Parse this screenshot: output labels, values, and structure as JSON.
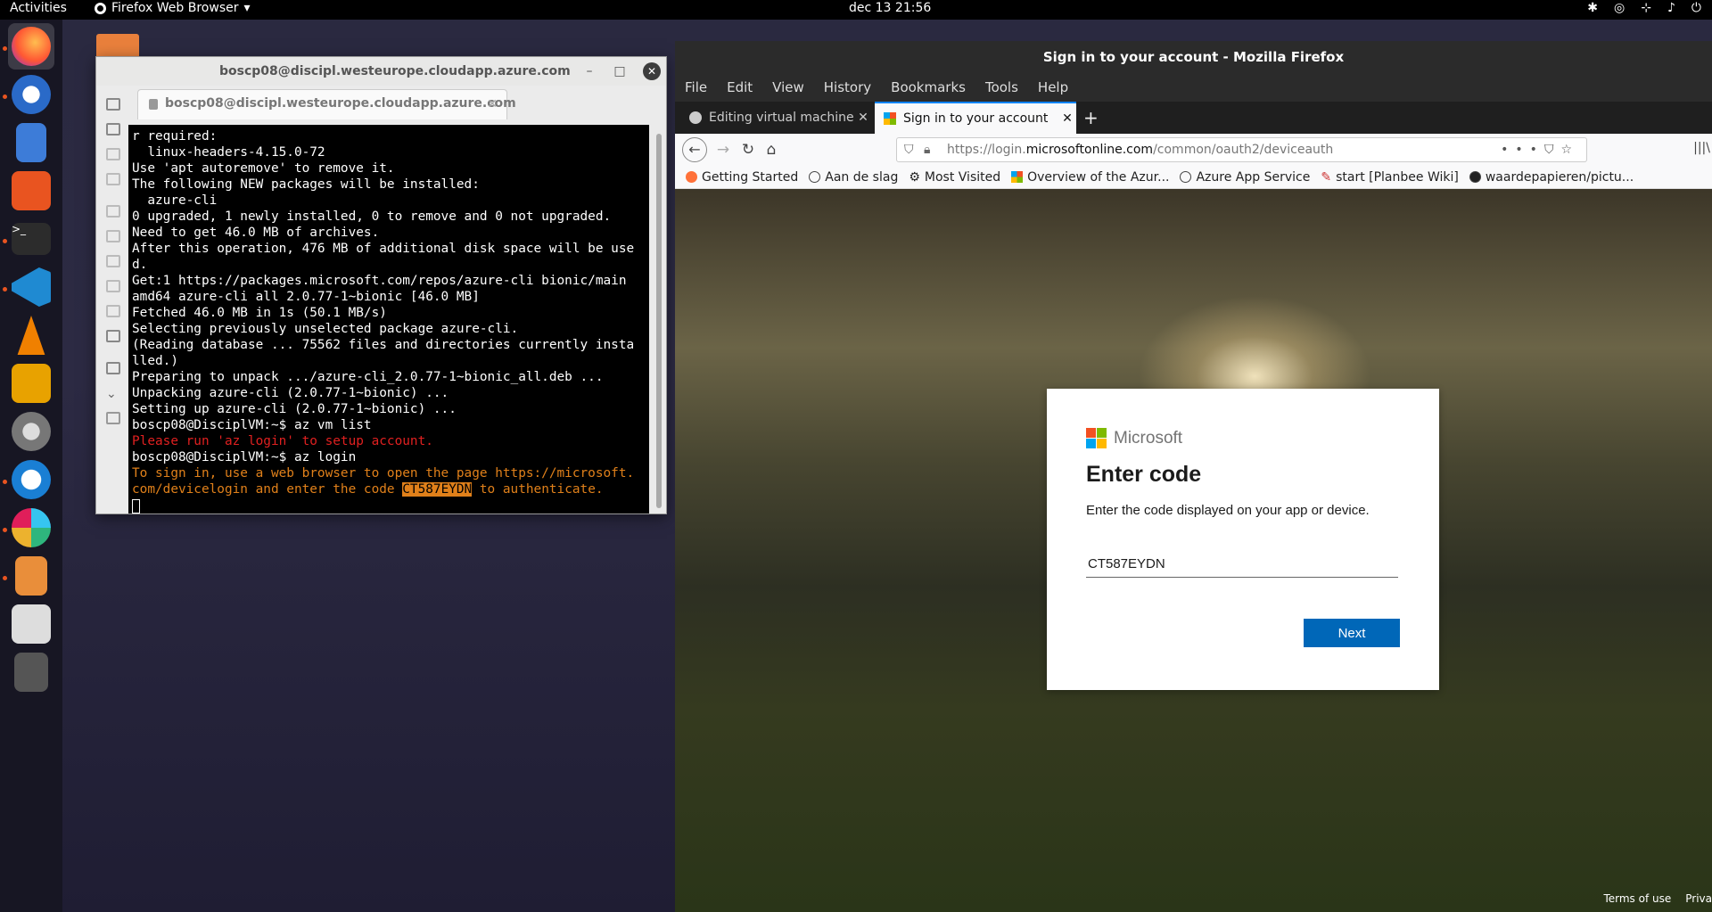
{
  "topbar": {
    "activities": "Activities",
    "app_name": "Firefox Web Browser",
    "clock": "dec 13  21:56"
  },
  "dock": {
    "items": [
      "firefox-icon",
      "thunderbird-icon",
      "files-icon",
      "software-center-icon",
      "terminal-icon",
      "vscode-icon",
      "vlc-icon",
      "remmina-icon",
      "settings-icon",
      "teamviewer-icon",
      "slack-icon",
      "image-viewer-icon",
      "search-tool-icon",
      "disc-icon"
    ]
  },
  "terminal": {
    "window_title": "boscp08@discipl.westeurope.cloudapp.azure.com",
    "tab_title": "boscp08@discipl.westeurope.cloudapp.azure.com",
    "lines": [
      "r required:",
      "  linux-headers-4.15.0-72",
      "Use 'apt autoremove' to remove it.",
      "The following NEW packages will be installed:",
      "  azure-cli",
      "0 upgraded, 1 newly installed, 0 to remove and 0 not upgraded.",
      "Need to get 46.0 MB of archives.",
      "After this operation, 476 MB of additional disk space will be use",
      "d.",
      "Get:1 https://packages.microsoft.com/repos/azure-cli bionic/main",
      "amd64 azure-cli all 2.0.77-1~bionic [46.0 MB]",
      "Fetched 46.0 MB in 1s (50.1 MB/s)",
      "Selecting previously unselected package azure-cli.",
      "(Reading database ... 75562 files and directories currently insta",
      "lled.)",
      "Preparing to unpack .../azure-cli_2.0.77-1~bionic_all.deb ...",
      "Unpacking azure-cli (2.0.77-1~bionic) ...",
      "Setting up azure-cli (2.0.77-1~bionic) ...",
      "boscp08@DisciplVM:~$ az vm list"
    ],
    "error_line": "Please run 'az login' to setup account.",
    "login_line": "boscp08@DisciplVM:~$ az login",
    "signin_line1": "To sign in, use a web browser to open the page https://microsoft.",
    "signin_line2_a": "com/devicelogin and enter the code ",
    "signin_code": "CT587EYDN",
    "signin_line2_b": " to authenticate."
  },
  "firefox": {
    "window_title": "Sign in to your account - Mozilla Firefox",
    "menu": [
      "File",
      "Edit",
      "View",
      "History",
      "Bookmarks",
      "Tools",
      "Help"
    ],
    "tabs": [
      {
        "title": "Editing virtual machines f"
      },
      {
        "title": "Sign in to your account"
      }
    ],
    "url_prefix": "https://login.",
    "url_domain": "microsoftonline.com",
    "url_path": "/common/oauth2/deviceauth",
    "bookmarks": [
      "Getting Started",
      "Aan de slag",
      "Most Visited",
      "Overview of the Azur...",
      "Azure App Service",
      "start [Planbee Wiki]",
      "waardepapieren/pictu..."
    ],
    "dialog": {
      "brand": "Microsoft",
      "title": "Enter code",
      "subtitle": "Enter the code displayed on your app or device.",
      "code_value": "CT587EYDN",
      "next_label": "Next"
    },
    "footer": {
      "terms": "Terms of use",
      "privacy": "Priva"
    }
  }
}
